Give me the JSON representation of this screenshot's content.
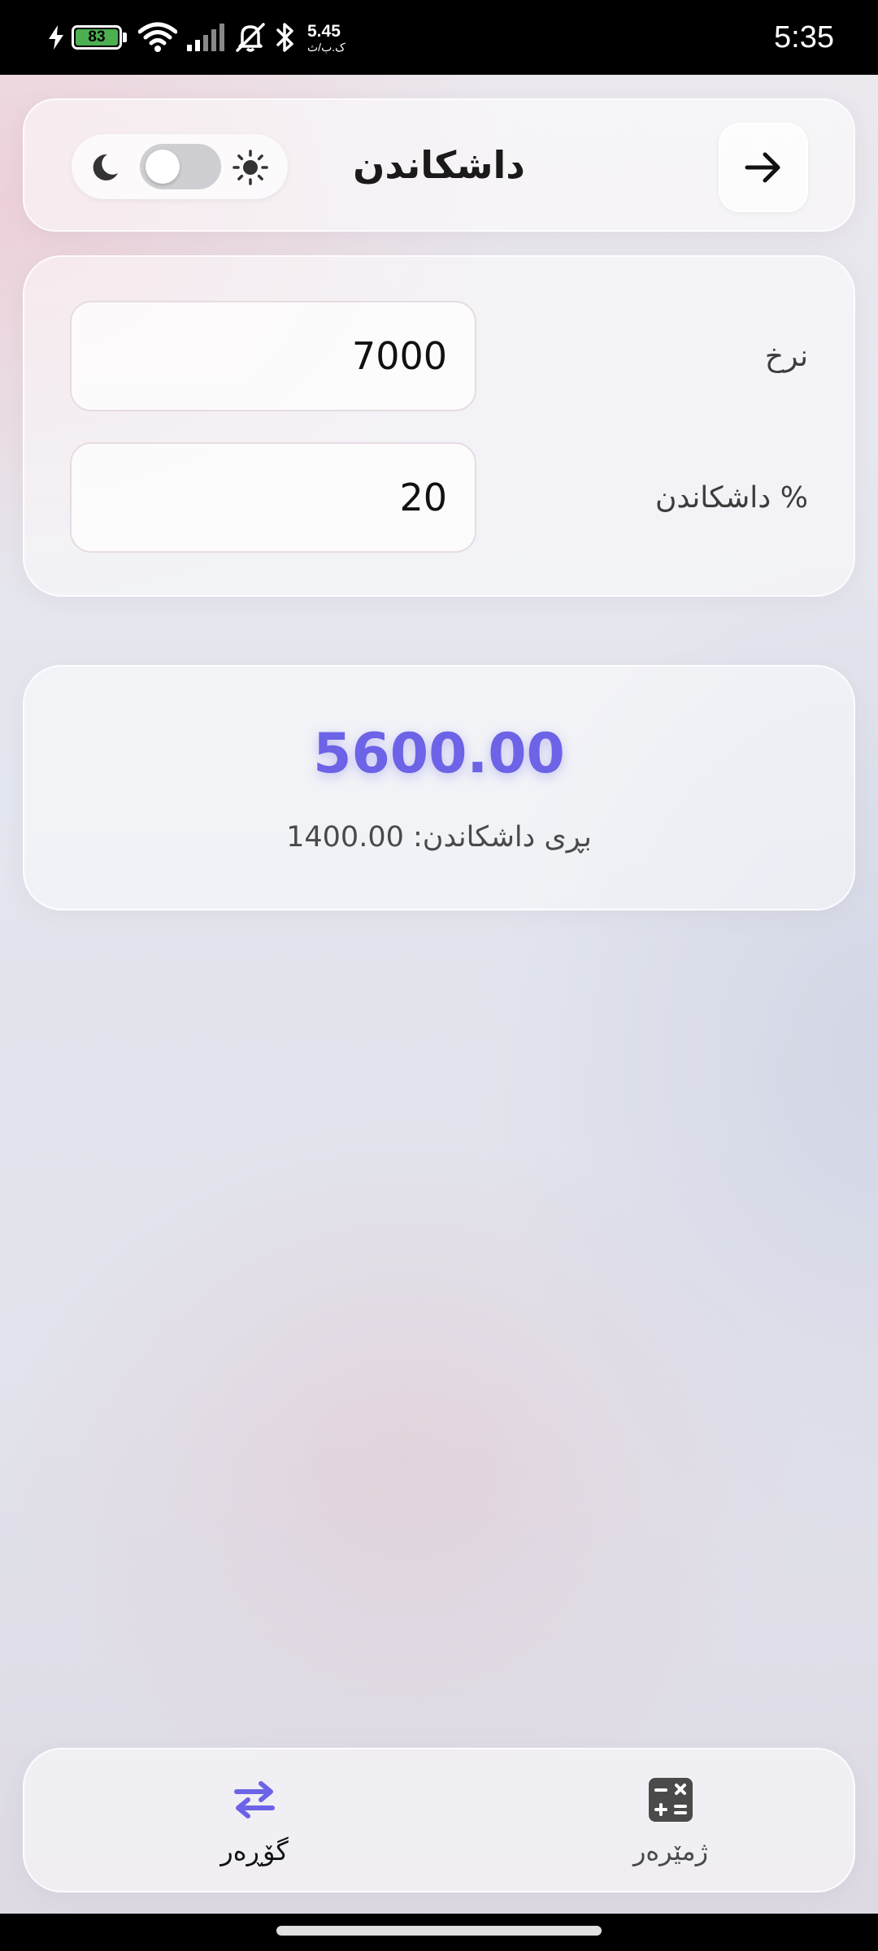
{
  "status_bar": {
    "battery_level": "83",
    "network_speed_value": "5.45",
    "network_speed_unit": "ک.ب/ث",
    "time": "5:35",
    "icons": [
      "charging-icon",
      "battery-icon",
      "wifi-icon",
      "signal-icon",
      "mute-bell-icon",
      "bluetooth-icon"
    ]
  },
  "header": {
    "title": "داشکاندن",
    "theme_toggle": {
      "state": "light",
      "left_icon": "moon-icon",
      "right_icon": "sun-icon"
    },
    "back_icon": "arrow-right-icon"
  },
  "form": {
    "price_label": "نرخ",
    "price_value": "7000",
    "discount_label": "داشکاندن %",
    "discount_value": "20"
  },
  "result": {
    "final_price": "5600.00",
    "discount_amount_text": "بڕی داشکاندن: 1400.00"
  },
  "bottom_nav": {
    "items": [
      {
        "label": "گۆڕەر",
        "icon": "swap-arrows-icon",
        "active": true
      },
      {
        "label": "ژمێرەر",
        "icon": "calculator-icon",
        "active": false
      }
    ]
  },
  "colors": {
    "accent": "#6c63e6",
    "status_bar_bg": "#000000",
    "battery_fill": "#4caf50"
  }
}
